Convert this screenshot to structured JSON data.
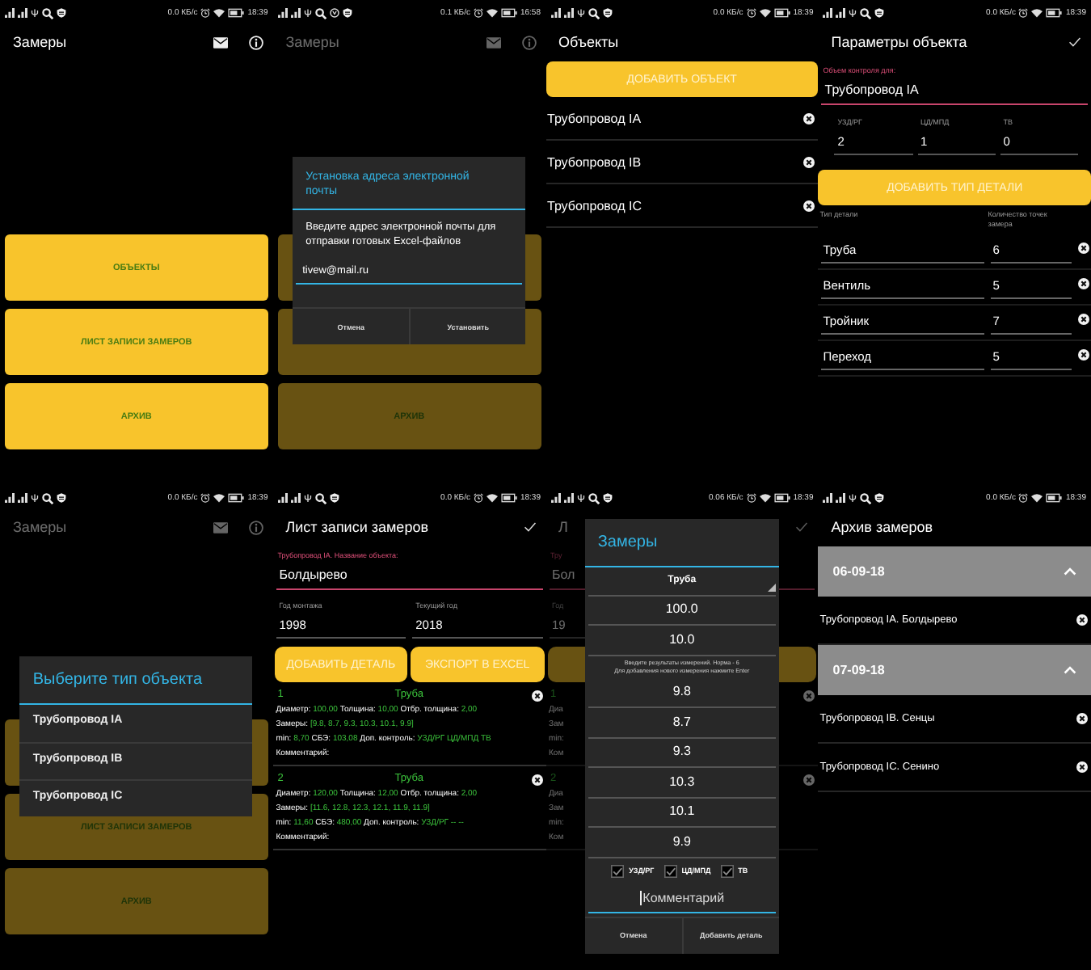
{
  "screens": [
    {
      "kind": "home",
      "status_bar": {
        "speed": "0.0 КБ/с",
        "time": "18:39"
      },
      "app_bar": {
        "title": "Замеры"
      },
      "buttons": [
        {
          "kind": "text",
          "label": "ОБЪЕКТЫ"
        },
        {
          "kind": "text",
          "label": "ЛИСТ ЗАПИСИ ЗАМЕРОВ"
        },
        {
          "kind": "text",
          "label": "АРХИВ"
        }
      ]
    },
    {
      "kind": "home",
      "status_bar": {
        "speed": "0.1 КБ/с",
        "time": "16:58",
        "extra_icon": true
      },
      "app_bar": {
        "title": "Замеры"
      },
      "buttons": [
        {
          "kind": "blank"
        },
        {
          "kind": "blank"
        },
        {
          "kind": "text",
          "label": "АРХИВ"
        }
      ],
      "dialog": {
        "kind": "prompt",
        "title": "Установка адреса электронной почты",
        "message": "Введите адрес электронной почты для отправки готовых Excel-файлов",
        "value": "tivew@mail.ru",
        "buttons": [
          "Отмена",
          "Установить"
        ]
      }
    },
    {
      "kind": "objects",
      "status_bar": {
        "speed": "0.0 КБ/с",
        "time": "18:39"
      },
      "app_bar": {
        "title": "Объекты"
      },
      "add_button": "ДОБАВИТЬ ОБЪЕКТ",
      "items": [
        "Трубопровод IA",
        "Трубопровод IB",
        "Трубопровод IC"
      ]
    },
    {
      "kind": "object_params",
      "status_bar": {
        "speed": "0.0 КБ/с",
        "time": "18:39"
      },
      "app_bar": {
        "title": "Параметры объекта"
      },
      "name_field": {
        "label": "Объем контроля для:",
        "value": "Трубопровод IA"
      },
      "counts": [
        {
          "label": "УЗД/РГ",
          "value": "2"
        },
        {
          "label": "ЦД/МПД",
          "value": "1"
        },
        {
          "label": "ТВ",
          "value": "0"
        }
      ],
      "add_button": "ДОБАВИТЬ ТИП ДЕТАЛИ",
      "columns": [
        "Тип детали",
        "Количество точек замера"
      ],
      "rows": [
        {
          "type": "Труба",
          "points": "6"
        },
        {
          "type": "Вентиль",
          "points": "5"
        },
        {
          "type": "Тройник",
          "points": "7"
        },
        {
          "type": "Переход",
          "points": "5"
        }
      ]
    },
    {
      "kind": "home",
      "status_bar": {
        "speed": "0.0 КБ/с",
        "time": "18:39"
      },
      "app_bar": {
        "title": "Замеры"
      },
      "buttons": [
        {
          "kind": "blank"
        },
        {
          "kind": "text",
          "label": "ЛИСТ ЗАПИСИ ЗАМЕРОВ"
        },
        {
          "kind": "text",
          "label": "АРХИВ"
        }
      ],
      "dialog": {
        "kind": "list",
        "title": "Выберите тип объекта",
        "items": [
          "Трубопровод IA",
          "Трубопровод IB",
          "Трубопровод IC"
        ]
      }
    },
    {
      "kind": "measure_sheet",
      "status_bar": {
        "speed": "0.0 КБ/с",
        "time": "18:39"
      },
      "app_bar": {
        "title": "Лист записи замеров"
      },
      "name_field": {
        "label": "Трубопровод IA. Название объекта:",
        "value": "Болдырево"
      },
      "years": [
        {
          "label": "Год монтажа",
          "value": "1998"
        },
        {
          "label": "Текущий год",
          "value": "2018"
        }
      ],
      "buttons": [
        {
          "kind": "text",
          "label": "ДОБАВИТЬ ДЕТАЛЬ"
        },
        {
          "kind": "text",
          "label": "ЭКСПОРТ В EXCEL"
        }
      ],
      "entries": [
        {
          "index": "1",
          "title": "Труба",
          "lines": [
            [
              {
                "label": "Диаметр:",
                "value": "100,00"
              },
              {
                "label": "Толщина:",
                "value": "10,00"
              },
              {
                "label": "Отбр. толщина:",
                "value": "2,00"
              }
            ],
            [
              {
                "label": "Замеры:",
                "value": "[9.8, 8.7, 9.3, 10.3, 10.1, 9.9]"
              }
            ],
            [
              {
                "label": "min:",
                "value": "8,70"
              },
              {
                "label": "СБЭ:",
                "value": "103,08"
              },
              {
                "label": "Доп. контроль:",
                "value": "УЗД/РГ ЦД/МПД ТВ"
              }
            ],
            [
              {
                "label": "Комментарий:"
              }
            ]
          ]
        },
        {
          "index": "2",
          "title": "Труба",
          "lines": [
            [
              {
                "label": "Диаметр:",
                "value": "120,00"
              },
              {
                "label": "Толщина:",
                "value": "12,00"
              },
              {
                "label": "Отбр. толщина:",
                "value": "2,00"
              }
            ],
            [
              {
                "label": "Замеры:",
                "value": "[11.6, 12.8, 12.3, 12.1, 11.9, 11.9]"
              }
            ],
            [
              {
                "label": "min:",
                "value": "11,60"
              },
              {
                "label": "СБЭ:",
                "value": "480,00"
              },
              {
                "label": "Доп. контроль:",
                "value": "УЗД/РГ -- --"
              }
            ],
            [
              {
                "label": "Комментарий:"
              }
            ]
          ]
        }
      ]
    },
    {
      "kind": "measure_sheet",
      "status_bar": {
        "speed": "0.06 КБ/с",
        "time": "18:39"
      },
      "app_bar": {
        "title": "Л"
      },
      "name_field": {
        "label": "Тру",
        "value": "Бол"
      },
      "years": [
        {
          "label": "Год",
          "value": "19"
        }
      ],
      "buttons": [
        {
          "kind": "blank"
        },
        {
          "kind": "blank"
        }
      ],
      "entries": [
        {
          "index": "1",
          "lines": [
            [
              {
                "label": "Диа"
              }
            ],
            [
              {
                "label": "Зам"
              }
            ],
            [
              {
                "label": "min:"
              }
            ],
            [
              {
                "label": "Ком"
              }
            ]
          ]
        },
        {
          "index": "2",
          "lines": [
            [
              {
                "label": "Диа"
              }
            ],
            [
              {
                "label": "Зам"
              }
            ],
            [
              {
                "label": "min:"
              }
            ],
            [
              {
                "label": "Ком"
              }
            ]
          ]
        }
      ],
      "dialog": {
        "kind": "measurements",
        "title": "Замеры",
        "spinner": "Труба",
        "fields": [
          "100.0",
          "10.0"
        ],
        "hint": [
          "Введите результаты измерений. Норма - 6",
          "Для добавления нового измерения нажмите Enter"
        ],
        "measurements": [
          "9.8",
          "8.7",
          "9.3",
          "10.3",
          "10.1",
          "9.9"
        ],
        "checkboxes": [
          {
            "label": "УЗД/РГ",
            "checked": true
          },
          {
            "label": "ЦД/МПД",
            "checked": true
          },
          {
            "label": "ТВ",
            "checked": true
          }
        ],
        "comment": {
          "placeholder": "Комментарий"
        },
        "buttons": [
          "Отмена",
          "Добавить деталь"
        ]
      }
    },
    {
      "kind": "archive",
      "status_bar": {
        "speed": "0.0 КБ/с",
        "time": "18:39"
      },
      "app_bar": {
        "title": "Архив замеров"
      },
      "groups": [
        {
          "date": "06-09-18",
          "expanded": true,
          "items": [
            "Трубопровод IA. Болдырево"
          ]
        },
        {
          "date": "07-09-18",
          "expanded": true,
          "items": [
            "Трубопровод IB. Сенцы",
            "Трубопровод IC. Сенино"
          ]
        }
      ]
    }
  ]
}
